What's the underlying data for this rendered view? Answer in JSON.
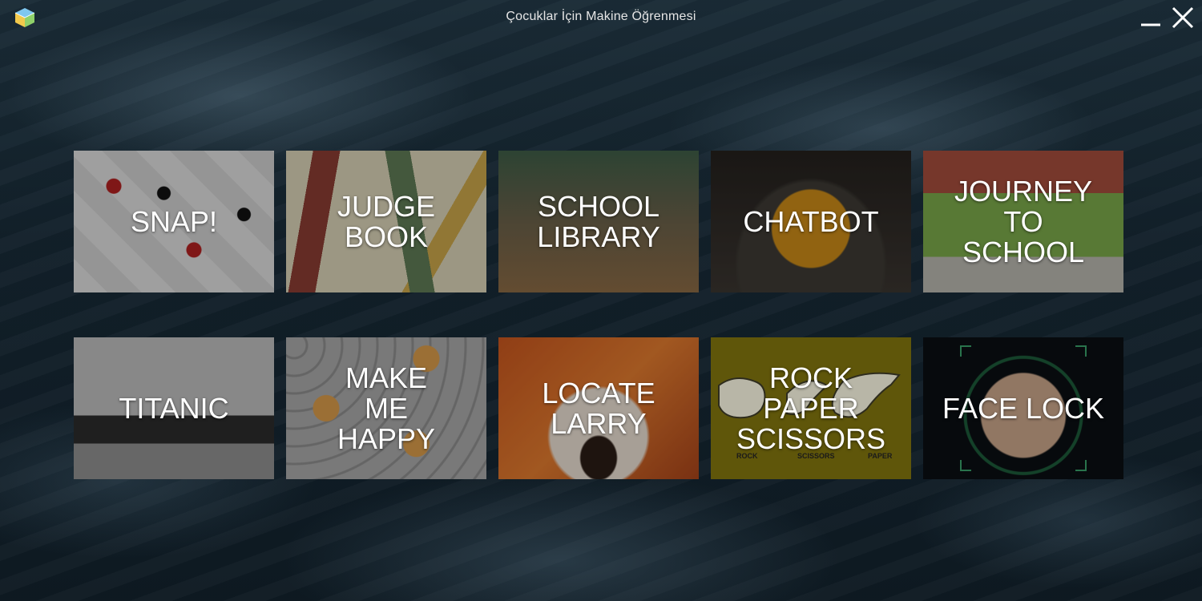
{
  "window": {
    "title": "Çocuklar İçin Makine Öğrenmesi",
    "app_icon": "cube-app-icon",
    "controls": {
      "minimize_icon": "minimize-icon",
      "close_icon": "close-icon"
    }
  },
  "tiles": [
    {
      "label": "SNAP!",
      "image": "playing-card-suits-pattern"
    },
    {
      "label": "JUDGE\nBOOK",
      "image": "books-pattern"
    },
    {
      "label": "SCHOOL\nLIBRARY",
      "image": "classroom-photo"
    },
    {
      "label": "CHATBOT",
      "image": "lion-mascot"
    },
    {
      "label": "JOURNEY\nTO\nSCHOOL",
      "image": "school-building-illustration"
    },
    {
      "label": "TITANIC",
      "image": "titanic-ship-photo"
    },
    {
      "label": "MAKE\nME\nHAPPY",
      "image": "emoji-faces-pattern"
    },
    {
      "label": "LOCATE\nLARRY",
      "image": "fox-closeup"
    },
    {
      "label": "ROCK\nPAPER\nSCISSORS",
      "image": "hand-gestures",
      "captions": [
        "ROCK",
        "SCISSORS",
        "PAPER"
      ]
    },
    {
      "label": "FACE LOCK",
      "image": "face-scan-photo"
    }
  ],
  "colors": {
    "label_text": "#ffffff",
    "title_text": "#e6e6e6",
    "rps_tile": "#5f560a"
  }
}
